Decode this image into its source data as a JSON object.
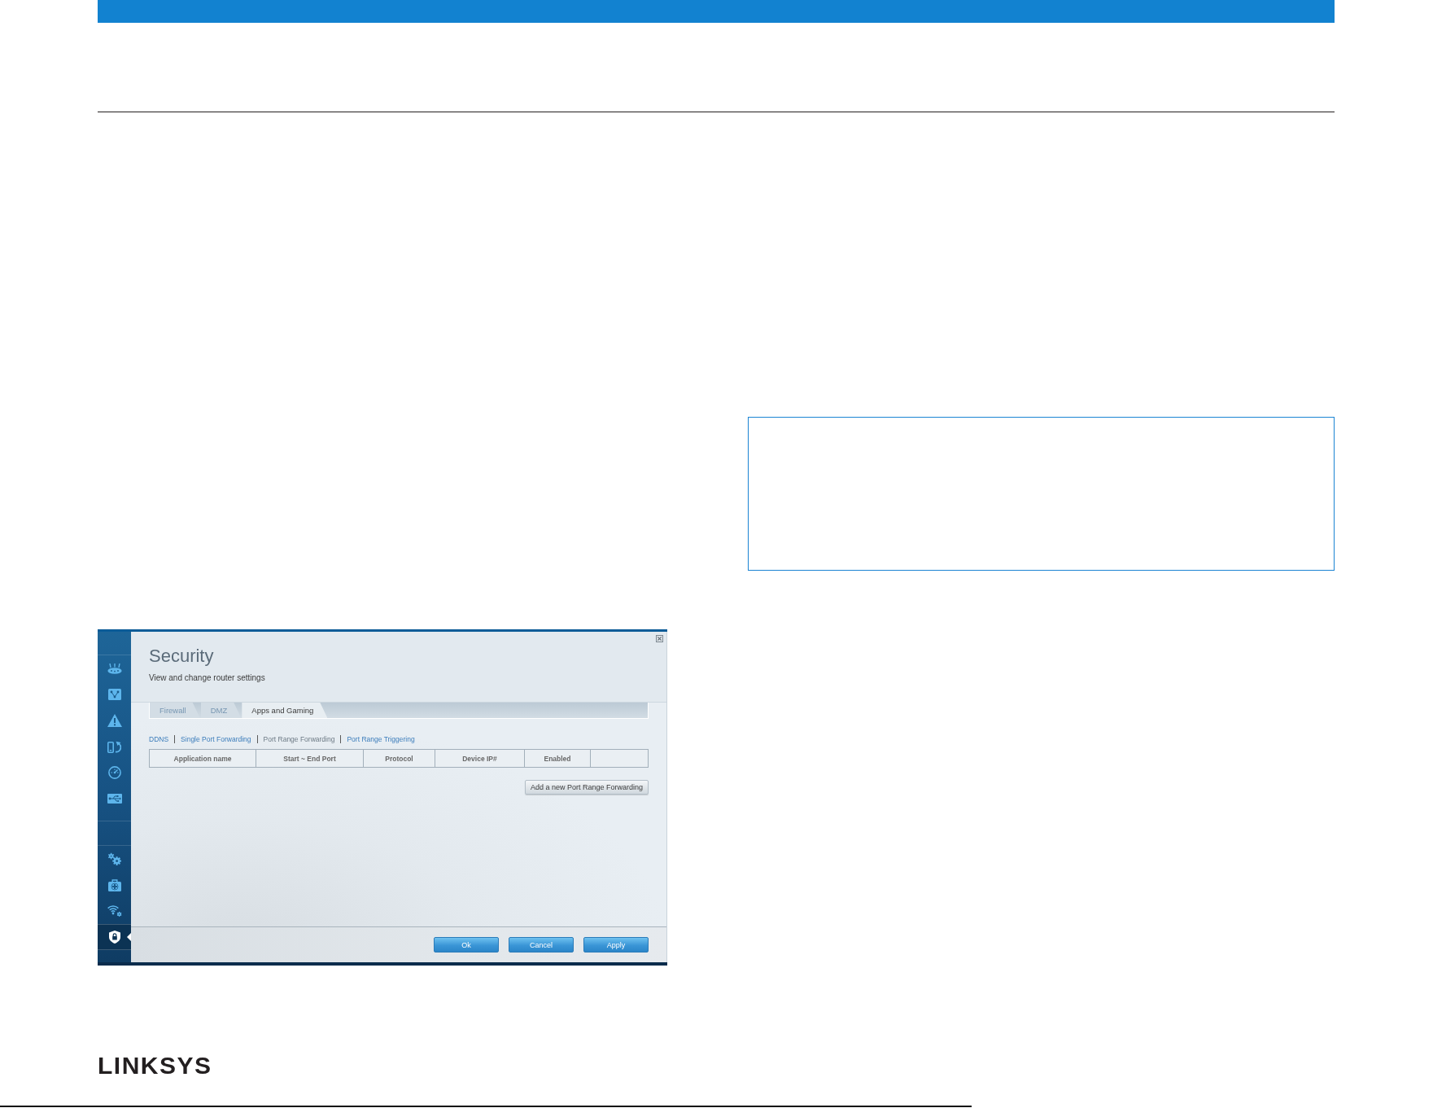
{
  "app_window": {
    "sidebar": {
      "groups": [
        {
          "items": [
            {
              "kind": "router",
              "selected": false
            },
            {
              "kind": "network",
              "selected": false
            },
            {
              "kind": "warning",
              "selected": false
            },
            {
              "kind": "devices",
              "selected": false
            },
            {
              "kind": "gauge",
              "selected": false
            },
            {
              "kind": "usb",
              "selected": false
            }
          ]
        },
        {
          "items": [
            {
              "kind": "gears",
              "selected": false
            },
            {
              "kind": "firstaid",
              "selected": false
            },
            {
              "kind": "wireless",
              "selected": false
            },
            {
              "kind": "shield",
              "selected": true
            }
          ]
        }
      ]
    },
    "title": "Security",
    "subtitle": "View and change router settings",
    "tabs": [
      {
        "label": "Firewall",
        "selected": false
      },
      {
        "label": "DMZ",
        "selected": false
      },
      {
        "label": "Apps and Gaming",
        "selected": true
      }
    ],
    "sub_tabs": [
      {
        "label": "DDNS",
        "selected": false
      },
      {
        "label": "Single Port Forwarding",
        "selected": false
      },
      {
        "label": "Port Range Forwarding",
        "selected": true
      },
      {
        "label": "Port Range Triggering",
        "selected": false
      }
    ],
    "table": {
      "columns": [
        "Application name",
        "Start ~ End Port",
        "Protocol",
        "Device IP#",
        "Enabled"
      ]
    },
    "add_button": "Add a new Port Range Forwarding",
    "buttons": [
      "Ok",
      "Cancel",
      "Apply"
    ]
  },
  "logo": {
    "text": "LINKSYS"
  }
}
